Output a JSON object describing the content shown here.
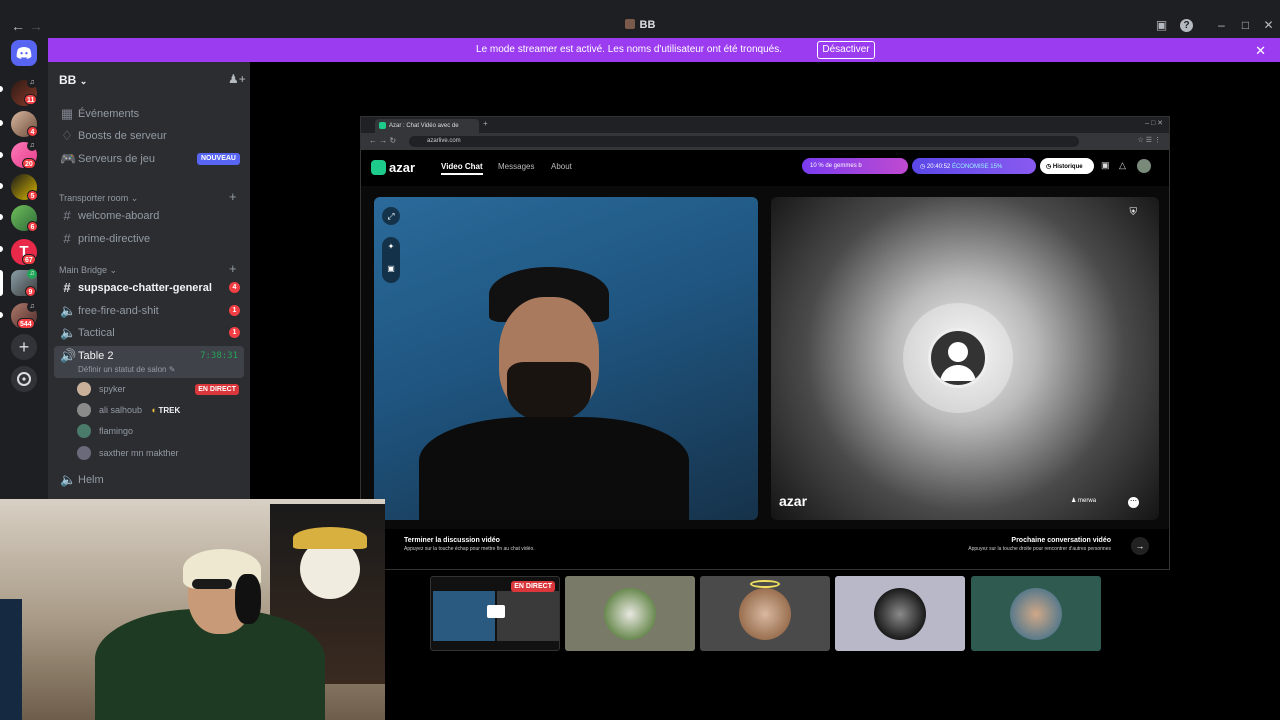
{
  "window": {
    "title": "BB"
  },
  "banner": {
    "text": "Le mode streamer est activé. Les noms d'utilisateur ont été tronqués.",
    "button": "Désactiver"
  },
  "guilds": {
    "badges": [
      "11",
      "4",
      "20",
      "5",
      "6",
      "67",
      "9",
      "544"
    ]
  },
  "server": {
    "name": "BB",
    "top_items": [
      {
        "label": "Événements",
        "icon": "calendar-icon"
      },
      {
        "label": "Boosts de serveur",
        "icon": "boost-icon"
      },
      {
        "label": "Serveurs de jeu",
        "icon": "gamepad-icon",
        "badge": "NOUVEAU"
      }
    ],
    "categories": [
      {
        "name": "Transporter room",
        "channels": [
          "welcome-aboard",
          "prime-directive"
        ]
      },
      {
        "name": "Main Bridge"
      }
    ],
    "bridge_channels": [
      {
        "name": "supspace-chatter-general",
        "badge": "4"
      },
      {
        "name": "free-fire-and-shit",
        "badge": "1"
      },
      {
        "name": "Tactical",
        "badge": "1"
      }
    ],
    "voice_channel": {
      "name": "Table 2",
      "timer": "7:38:31",
      "status": "Définir un statut de salon",
      "members": [
        {
          "name": "spyker",
          "live": "EN DIRECT"
        },
        {
          "name": "ali salhoub",
          "tag": "TREK"
        },
        {
          "name": "flamingo"
        },
        {
          "name": "saxther mn makther"
        }
      ]
    },
    "last_channel": "Helm"
  },
  "azar": {
    "tab_title": "Azar : Chat Vidéo avec de",
    "url": "azarlive.com",
    "logo": "azar",
    "nav": [
      "Video Chat",
      "Messages",
      "About"
    ],
    "promo": "10 % de gemmes b",
    "timer": "20:40:52",
    "economize": "ÉCONOMISE 15%",
    "history": "Historique",
    "watermark": "azar",
    "end_title": "Terminer la discussion vidéo",
    "end_sub": "Appuyez sur la touche échap pour mettre fin au chat vidéo.",
    "next_title": "Prochaine conversation vidéo",
    "next_sub": "Appuyez sur la touche droite pour rencontrer d'autres personnes",
    "user_tag": "merwa"
  },
  "tiles": {
    "live": "EN DIRECT"
  },
  "colors": {
    "accent": "#5865f2",
    "banner": "#9b3cf0",
    "danger": "#da373c",
    "online": "#23a55a"
  }
}
